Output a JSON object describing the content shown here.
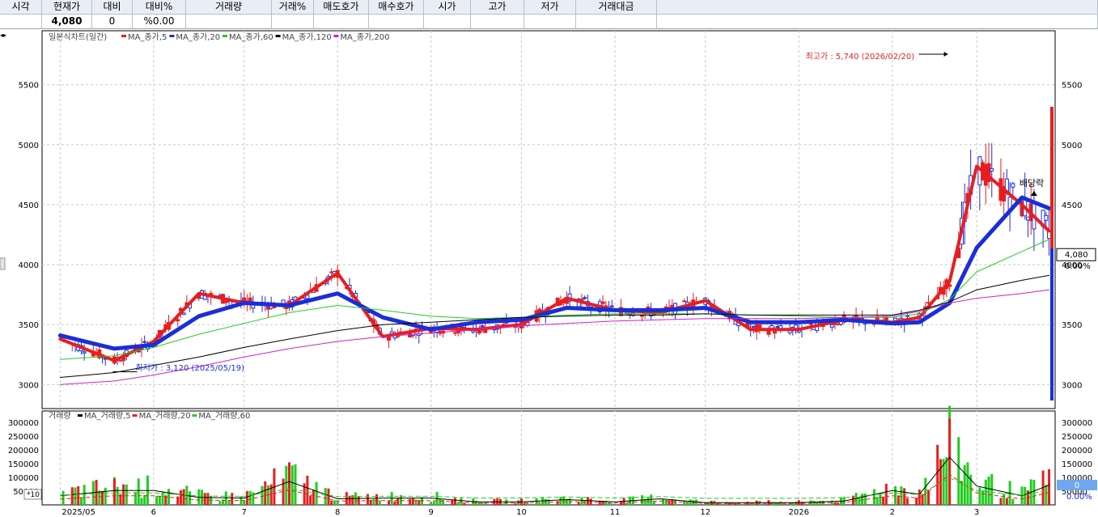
{
  "header": {
    "labels": [
      "시각",
      "현재가",
      "대비",
      "대비%",
      "거래량",
      "거래%",
      "매도호가",
      "매수호가",
      "시가",
      "고가",
      "저가",
      "거래대금"
    ],
    "values": [
      "",
      "4,080",
      "0",
      "%0.00",
      "",
      "",
      "",
      "",
      "",
      "",
      "",
      ""
    ]
  },
  "colors": {
    "ma5": "#e81e1e",
    "ma20": "#1a2ed8",
    "ma60": "#22cc22",
    "ma120": "#000000",
    "ma200": "#cc22cc",
    "up": "#e81e1e",
    "down": "#1a2ed8",
    "vol_ma5": "#000000",
    "vol_ma20": "#e81e1e",
    "vol_ma60": "#22cc22",
    "price_box_bg": "#ffffff",
    "vol_box_bg": "#6fa8f0"
  },
  "chart_data": [
    {
      "type": "line",
      "title": "일본식차트(일간)",
      "legend": [
        {
          "name": "MA_종가,5",
          "color": "#e81e1e"
        },
        {
          "name": "MA_종가,20",
          "color": "#1a2ed8"
        },
        {
          "name": "MA_종가,60",
          "color": "#22cc22"
        },
        {
          "name": "MA_종가,120",
          "color": "#000000"
        },
        {
          "name": "MA_종가,200",
          "color": "#cc22cc"
        }
      ],
      "x": [
        "2025-05-01",
        "2025-05-19",
        "2025-06-01",
        "2025-06-16",
        "2025-07-01",
        "2025-07-16",
        "2025-08-01",
        "2025-08-16",
        "2025-09-01",
        "2025-09-16",
        "2025-10-01",
        "2025-10-16",
        "2025-11-01",
        "2025-11-16",
        "2025-12-01",
        "2025-12-16",
        "2026-01-01",
        "2026-01-16",
        "2026-02-01",
        "2026-02-10",
        "2026-02-20",
        "2026-03-01",
        "2026-03-16",
        "2026-03-25"
      ],
      "series": [
        {
          "name": "MA_종가,5",
          "values": [
            3380,
            3200,
            3360,
            3760,
            3680,
            3660,
            3930,
            3400,
            3470,
            3460,
            3500,
            3720,
            3620,
            3600,
            3700,
            3460,
            3460,
            3540,
            3520,
            3560,
            3860,
            4820,
            4500,
            4280
          ]
        },
        {
          "name": "MA_종가,20",
          "values": [
            3410,
            3300,
            3330,
            3570,
            3680,
            3660,
            3760,
            3560,
            3460,
            3520,
            3540,
            3640,
            3620,
            3620,
            3640,
            3520,
            3520,
            3540,
            3510,
            3520,
            3680,
            4140,
            4560,
            4470
          ]
        },
        {
          "name": "MA_종가,60",
          "values": [
            3210,
            3240,
            3310,
            3420,
            3510,
            3600,
            3660,
            3620,
            3570,
            3550,
            3560,
            3580,
            3590,
            3590,
            3590,
            3580,
            3570,
            3560,
            3560,
            3590,
            3710,
            3940,
            4110,
            4210
          ]
        },
        {
          "name": "MA_종가,120",
          "values": [
            3060,
            3100,
            3160,
            3230,
            3310,
            3380,
            3450,
            3500,
            3520,
            3540,
            3560,
            3570,
            3580,
            3580,
            3590,
            3580,
            3580,
            3580,
            3580,
            3620,
            3690,
            3790,
            3870,
            3910
          ]
        },
        {
          "name": "MA_종가,200",
          "values": [
            3000,
            3030,
            3080,
            3150,
            3230,
            3300,
            3360,
            3400,
            3430,
            3460,
            3490,
            3510,
            3530,
            3540,
            3550,
            3550,
            3550,
            3560,
            3570,
            3610,
            3680,
            3720,
            3760,
            3790
          ]
        }
      ],
      "xticks": [
        "2025/05",
        "6",
        "7",
        "8",
        "9",
        "10",
        "11",
        "12",
        "2026",
        "2",
        "3"
      ],
      "ylim": [
        2800,
        5950
      ],
      "yticks": [
        3000,
        3500,
        4000,
        4500,
        5000,
        5500
      ],
      "annotations": [
        {
          "text": "최고가 : 5,740 (2026/02/20)",
          "x": "2026-02-20",
          "y": 5740
        },
        {
          "text": "최저가 : 3,120 (2025/05/19)",
          "x": "2025-05-19",
          "y": 3120
        },
        {
          "text": "배당락",
          "x": "2026-03-20",
          "y": 4580
        }
      ],
      "current_value": "4,080",
      "current_change": "0.00%"
    },
    {
      "type": "bar",
      "title": "거래량",
      "legend": [
        {
          "name": "MA_거래량,5",
          "color": "#000000"
        },
        {
          "name": "MA_거래량,20",
          "color": "#e81e1e"
        },
        {
          "name": "MA_거래량,60",
          "color": "#22cc22"
        }
      ],
      "x": [
        "2025-05-01",
        "2025-05-19",
        "2025-06-01",
        "2025-06-16",
        "2025-07-01",
        "2025-07-16",
        "2025-08-01",
        "2025-08-16",
        "2025-09-01",
        "2025-09-16",
        "2025-10-01",
        "2025-10-16",
        "2025-11-01",
        "2025-11-16",
        "2025-12-01",
        "2025-12-16",
        "2026-01-01",
        "2026-01-16",
        "2026-02-01",
        "2026-02-10",
        "2026-02-20",
        "2026-03-01",
        "2026-03-16",
        "2026-03-25"
      ],
      "values": [
        60000,
        95000,
        95000,
        50000,
        45000,
        155000,
        40000,
        45000,
        45000,
        20000,
        20000,
        35000,
        20000,
        40000,
        15000,
        15000,
        15000,
        25000,
        95000,
        70000,
        315000,
        125000,
        60000,
        130000
      ],
      "ylim": [
        0,
        330000
      ],
      "yticks": [
        50000,
        100000,
        150000,
        200000,
        250000,
        300000
      ],
      "ytick_labels": [
        "50000",
        "100000",
        "150000",
        "200000",
        "250000",
        "300000"
      ],
      "scale_label": "*10",
      "current_value": "0",
      "current_change": "0.00%"
    }
  ]
}
